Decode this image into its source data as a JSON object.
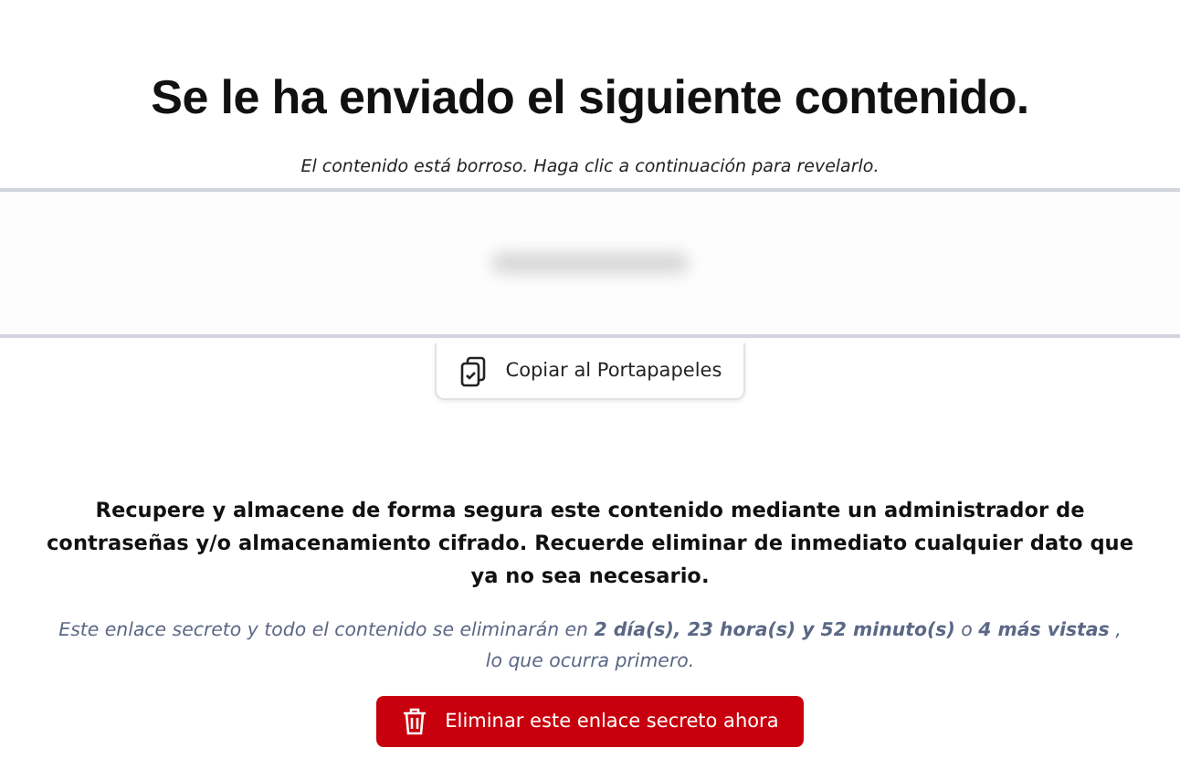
{
  "title": "Se le ha enviado el siguiente contenido.",
  "hint": "El contenido está borroso. Haga clic a continuación para revelarlo.",
  "secret": {
    "blurred": true
  },
  "copy_button": {
    "label": "Copiar al Portapapeles"
  },
  "warning": "Recupere y almacene de forma segura este contenido mediante un administrador de contraseñas y/o almacenamiento cifrado. Recuerde eliminar de inmediato cualquier dato que ya no sea necesario.",
  "expiry": "Este enlace secreto y todo el contenido se eliminarán en **2 día(s), 23 hora(s) y 52 minuto(s)** o **4 más vistas** , lo que ocurra primero.",
  "delete_button": {
    "label": "Eliminar este enlace secreto ahora"
  }
}
